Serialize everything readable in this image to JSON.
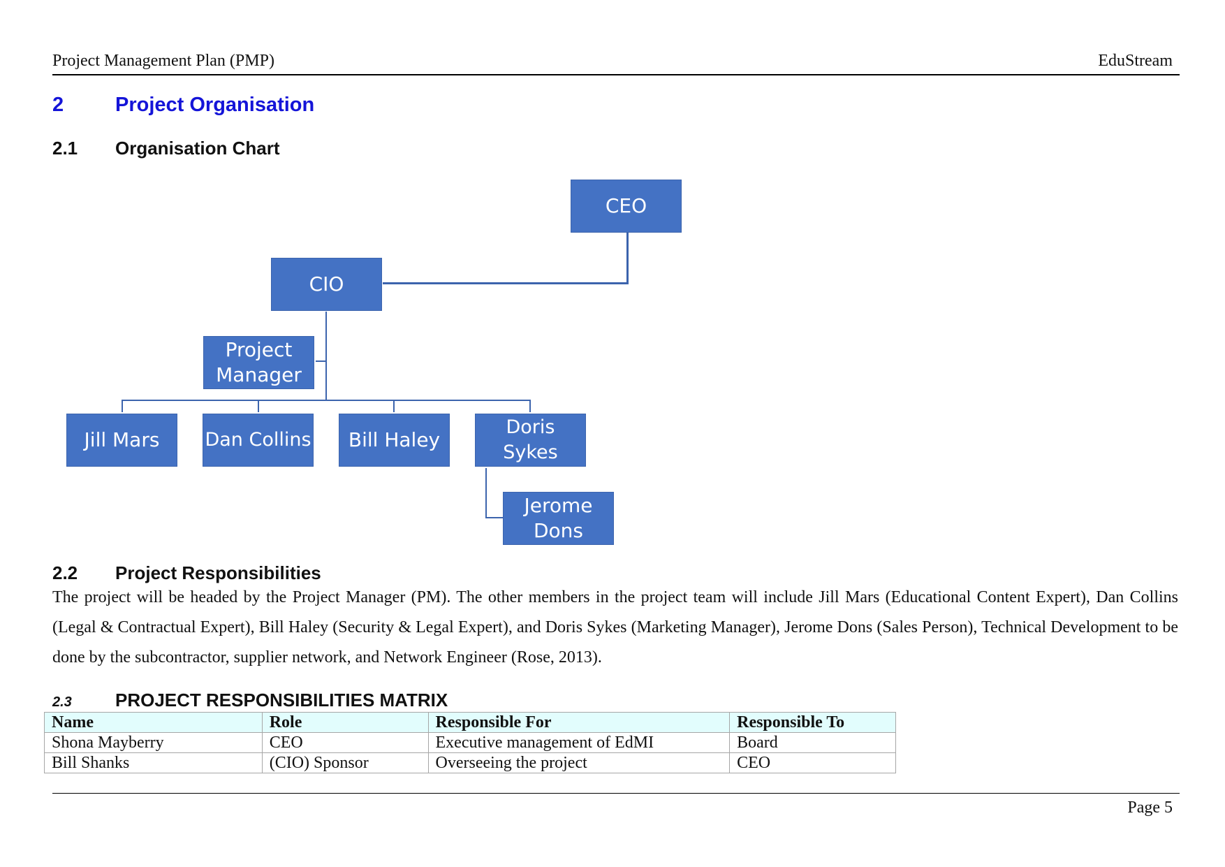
{
  "header": {
    "title": "Project Management Plan (PMP)",
    "company": "EduStream"
  },
  "section": {
    "number": "2",
    "title": "Project Organisation"
  },
  "subsections": {
    "org_chart": {
      "number": "2.1",
      "title": "Organisation Chart"
    },
    "responsibilities": {
      "number": "2.2",
      "title": "Project Responsibilities"
    },
    "matrix": {
      "number": "2.3",
      "title": "PROJECT RESPONSIBILITIES MATRIX"
    }
  },
  "org_chart": {
    "node_color": "#4472c4",
    "nodes": {
      "ceo": "CEO",
      "cio": "CIO",
      "project_manager": "Project Manager",
      "jill_mars": "Jill Mars",
      "dan_collins": "Dan Collins",
      "bill_haley": "Bill Haley",
      "doris_sykes": "Doris Sykes",
      "jerome_dons": "Jerome Dons"
    }
  },
  "responsibilities_text": "The project will be headed by the Project Manager (PM). The other members in the project team will include Jill Mars (Educational Content Expert), Dan Collins (Legal & Contractual Expert), Bill Haley (Security & Legal Expert), and Doris Sykes (Marketing Manager), Jerome Dons (Sales Person), Technical Development to be done by the subcontractor, supplier network, and Network Engineer (Rose, 2013).",
  "matrix": {
    "columns": [
      "Name",
      "Role",
      "Responsible For",
      "Responsible To"
    ],
    "rows": [
      [
        "Shona Mayberry",
        "CEO",
        "Executive management of EdMI",
        "Board"
      ],
      [
        "Bill Shanks",
        "(CIO) Sponsor",
        "Overseeing the project",
        "CEO"
      ]
    ]
  },
  "footer": {
    "page_label": "Page 5"
  }
}
